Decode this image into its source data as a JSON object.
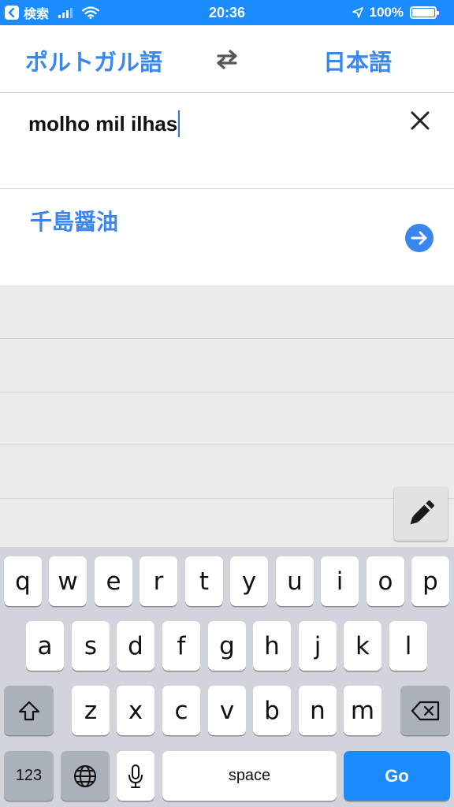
{
  "status_bar": {
    "back_label": "検索",
    "time": "20:36",
    "battery": "100%"
  },
  "languages": {
    "source": "ポルトガル語",
    "target": "日本語"
  },
  "input": {
    "text": "molho mil ilhas"
  },
  "result": {
    "text": "千島醤油"
  },
  "keyboard": {
    "row1": [
      "q",
      "w",
      "e",
      "r",
      "t",
      "y",
      "u",
      "i",
      "o",
      "p"
    ],
    "row2": [
      "a",
      "s",
      "d",
      "f",
      "g",
      "h",
      "j",
      "k",
      "l"
    ],
    "row3": [
      "z",
      "x",
      "c",
      "v",
      "b",
      "n",
      "m"
    ],
    "numbers_label": "123",
    "space_label": "space",
    "go_label": "Go"
  },
  "colors": {
    "accent": "#3a86ee",
    "status_bar": "#1a8cff",
    "go_key": "#1a8cff"
  }
}
